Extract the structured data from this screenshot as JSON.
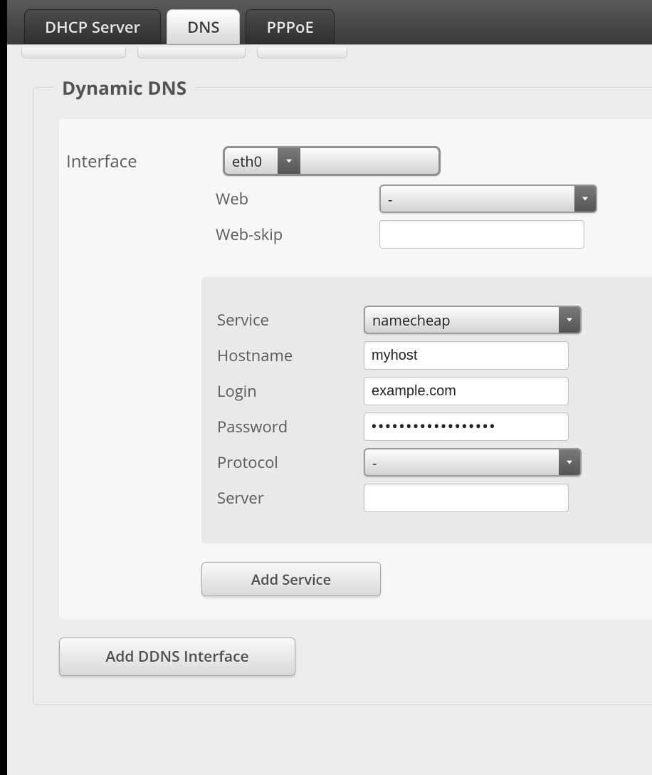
{
  "tabs": [
    {
      "label": "DHCP Server",
      "active": false
    },
    {
      "label": "DNS",
      "active": true
    },
    {
      "label": "PPPoE",
      "active": false
    }
  ],
  "section": {
    "legend": "Dynamic DNS"
  },
  "interface": {
    "label": "Interface",
    "value": "eth0",
    "web_label": "Web",
    "web_value": "-",
    "webskip_label": "Web-skip",
    "webskip_value": ""
  },
  "service": {
    "service_label": "Service",
    "service_value": "namecheap",
    "hostname_label": "Hostname",
    "hostname_value": "myhost",
    "login_label": "Login",
    "login_value": "example.com",
    "password_label": "Password",
    "password_value": "••••••••••••••••••",
    "protocol_label": "Protocol",
    "protocol_value": "-",
    "server_label": "Server",
    "server_value": ""
  },
  "buttons": {
    "add_service": "Add Service",
    "add_ddns_interface": "Add DDNS Interface"
  }
}
